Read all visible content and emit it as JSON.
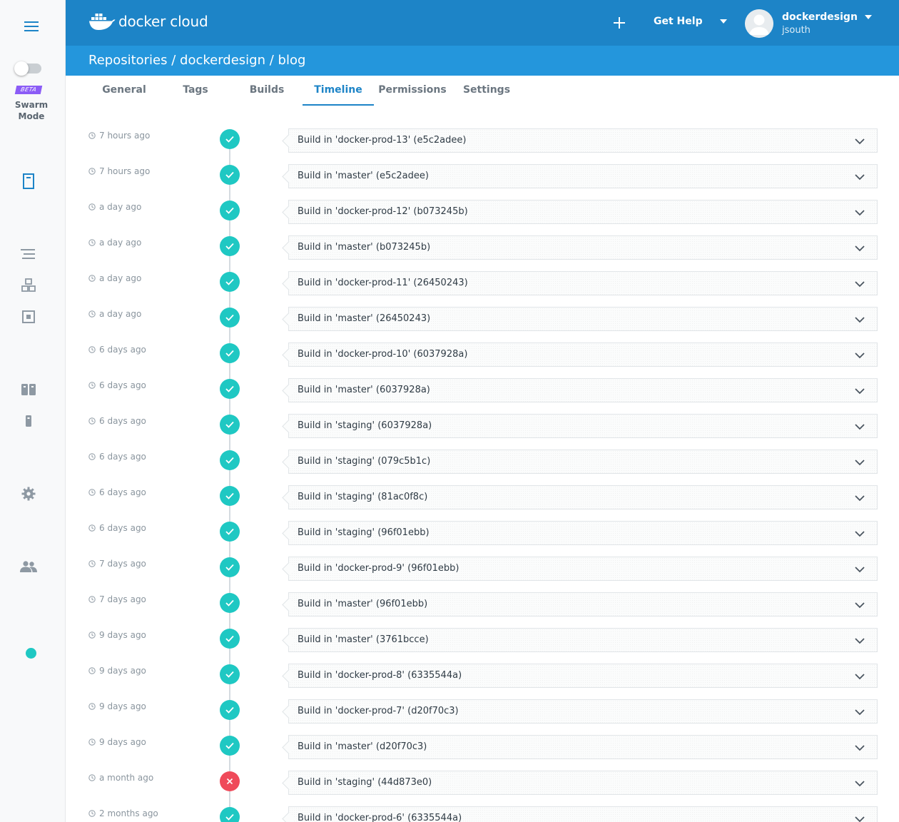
{
  "brand": {
    "logo_text": "docker cloud"
  },
  "header": {
    "help_label": "Get Help",
    "user_name": "dockerdesign",
    "user_sub": "jsouth"
  },
  "breadcrumb": "Repositories / dockerdesign / blog",
  "sidebar": {
    "beta_label": "BETA",
    "swarm_label_line1": "Swarm",
    "swarm_label_line2": "Mode",
    "icons": [
      "menu-icon",
      "repositories-icon",
      "stacks-icon",
      "services-icon",
      "containers-icon",
      "node-clusters-icon",
      "nodes-icon",
      "settings-icon",
      "team-icon"
    ]
  },
  "tabs": [
    {
      "label": "General"
    },
    {
      "label": "Tags"
    },
    {
      "label": "Builds"
    },
    {
      "label": "Timeline",
      "active": true
    },
    {
      "label": "Permissions"
    },
    {
      "label": "Settings"
    }
  ],
  "colors": {
    "header": "#1d84c7",
    "breadcrumb_bar": "#2496dc",
    "success": "#1fc8c3",
    "failure": "#ef4a5a",
    "beta": "#8b5cf6"
  },
  "timeline": [
    {
      "time": "7 hours ago",
      "status": "success",
      "title": "Build in 'docker-prod-13' (e5c2adee)"
    },
    {
      "time": "7 hours ago",
      "status": "success",
      "title": "Build in 'master' (e5c2adee)"
    },
    {
      "time": "a day ago",
      "status": "success",
      "title": "Build in 'docker-prod-12' (b073245b)"
    },
    {
      "time": "a day ago",
      "status": "success",
      "title": "Build in 'master' (b073245b)"
    },
    {
      "time": "a day ago",
      "status": "success",
      "title": "Build in 'docker-prod-11' (26450243)"
    },
    {
      "time": "a day ago",
      "status": "success",
      "title": "Build in 'master' (26450243)"
    },
    {
      "time": "6 days ago",
      "status": "success",
      "title": "Build in 'docker-prod-10' (6037928a)"
    },
    {
      "time": "6 days ago",
      "status": "success",
      "title": "Build in 'master' (6037928a)"
    },
    {
      "time": "6 days ago",
      "status": "success",
      "title": "Build in 'staging' (6037928a)"
    },
    {
      "time": "6 days ago",
      "status": "success",
      "title": "Build in 'staging' (079c5b1c)"
    },
    {
      "time": "6 days ago",
      "status": "success",
      "title": "Build in 'staging' (81ac0f8c)"
    },
    {
      "time": "6 days ago",
      "status": "success",
      "title": "Build in 'staging' (96f01ebb)"
    },
    {
      "time": "7 days ago",
      "status": "success",
      "title": "Build in 'docker-prod-9' (96f01ebb)"
    },
    {
      "time": "7 days ago",
      "status": "success",
      "title": "Build in 'master' (96f01ebb)"
    },
    {
      "time": "9 days ago",
      "status": "success",
      "title": "Build in 'master' (3761bcce)"
    },
    {
      "time": "9 days ago",
      "status": "success",
      "title": "Build in 'docker-prod-8' (6335544a)"
    },
    {
      "time": "9 days ago",
      "status": "success",
      "title": "Build in 'docker-prod-7' (d20f70c3)"
    },
    {
      "time": "9 days ago",
      "status": "success",
      "title": "Build in 'master' (d20f70c3)"
    },
    {
      "time": "a month ago",
      "status": "failure",
      "title": "Build in 'staging' (44d873e0)"
    },
    {
      "time": "2 months ago",
      "status": "success",
      "title": "Build in 'docker-prod-6' (6335544a)"
    }
  ]
}
